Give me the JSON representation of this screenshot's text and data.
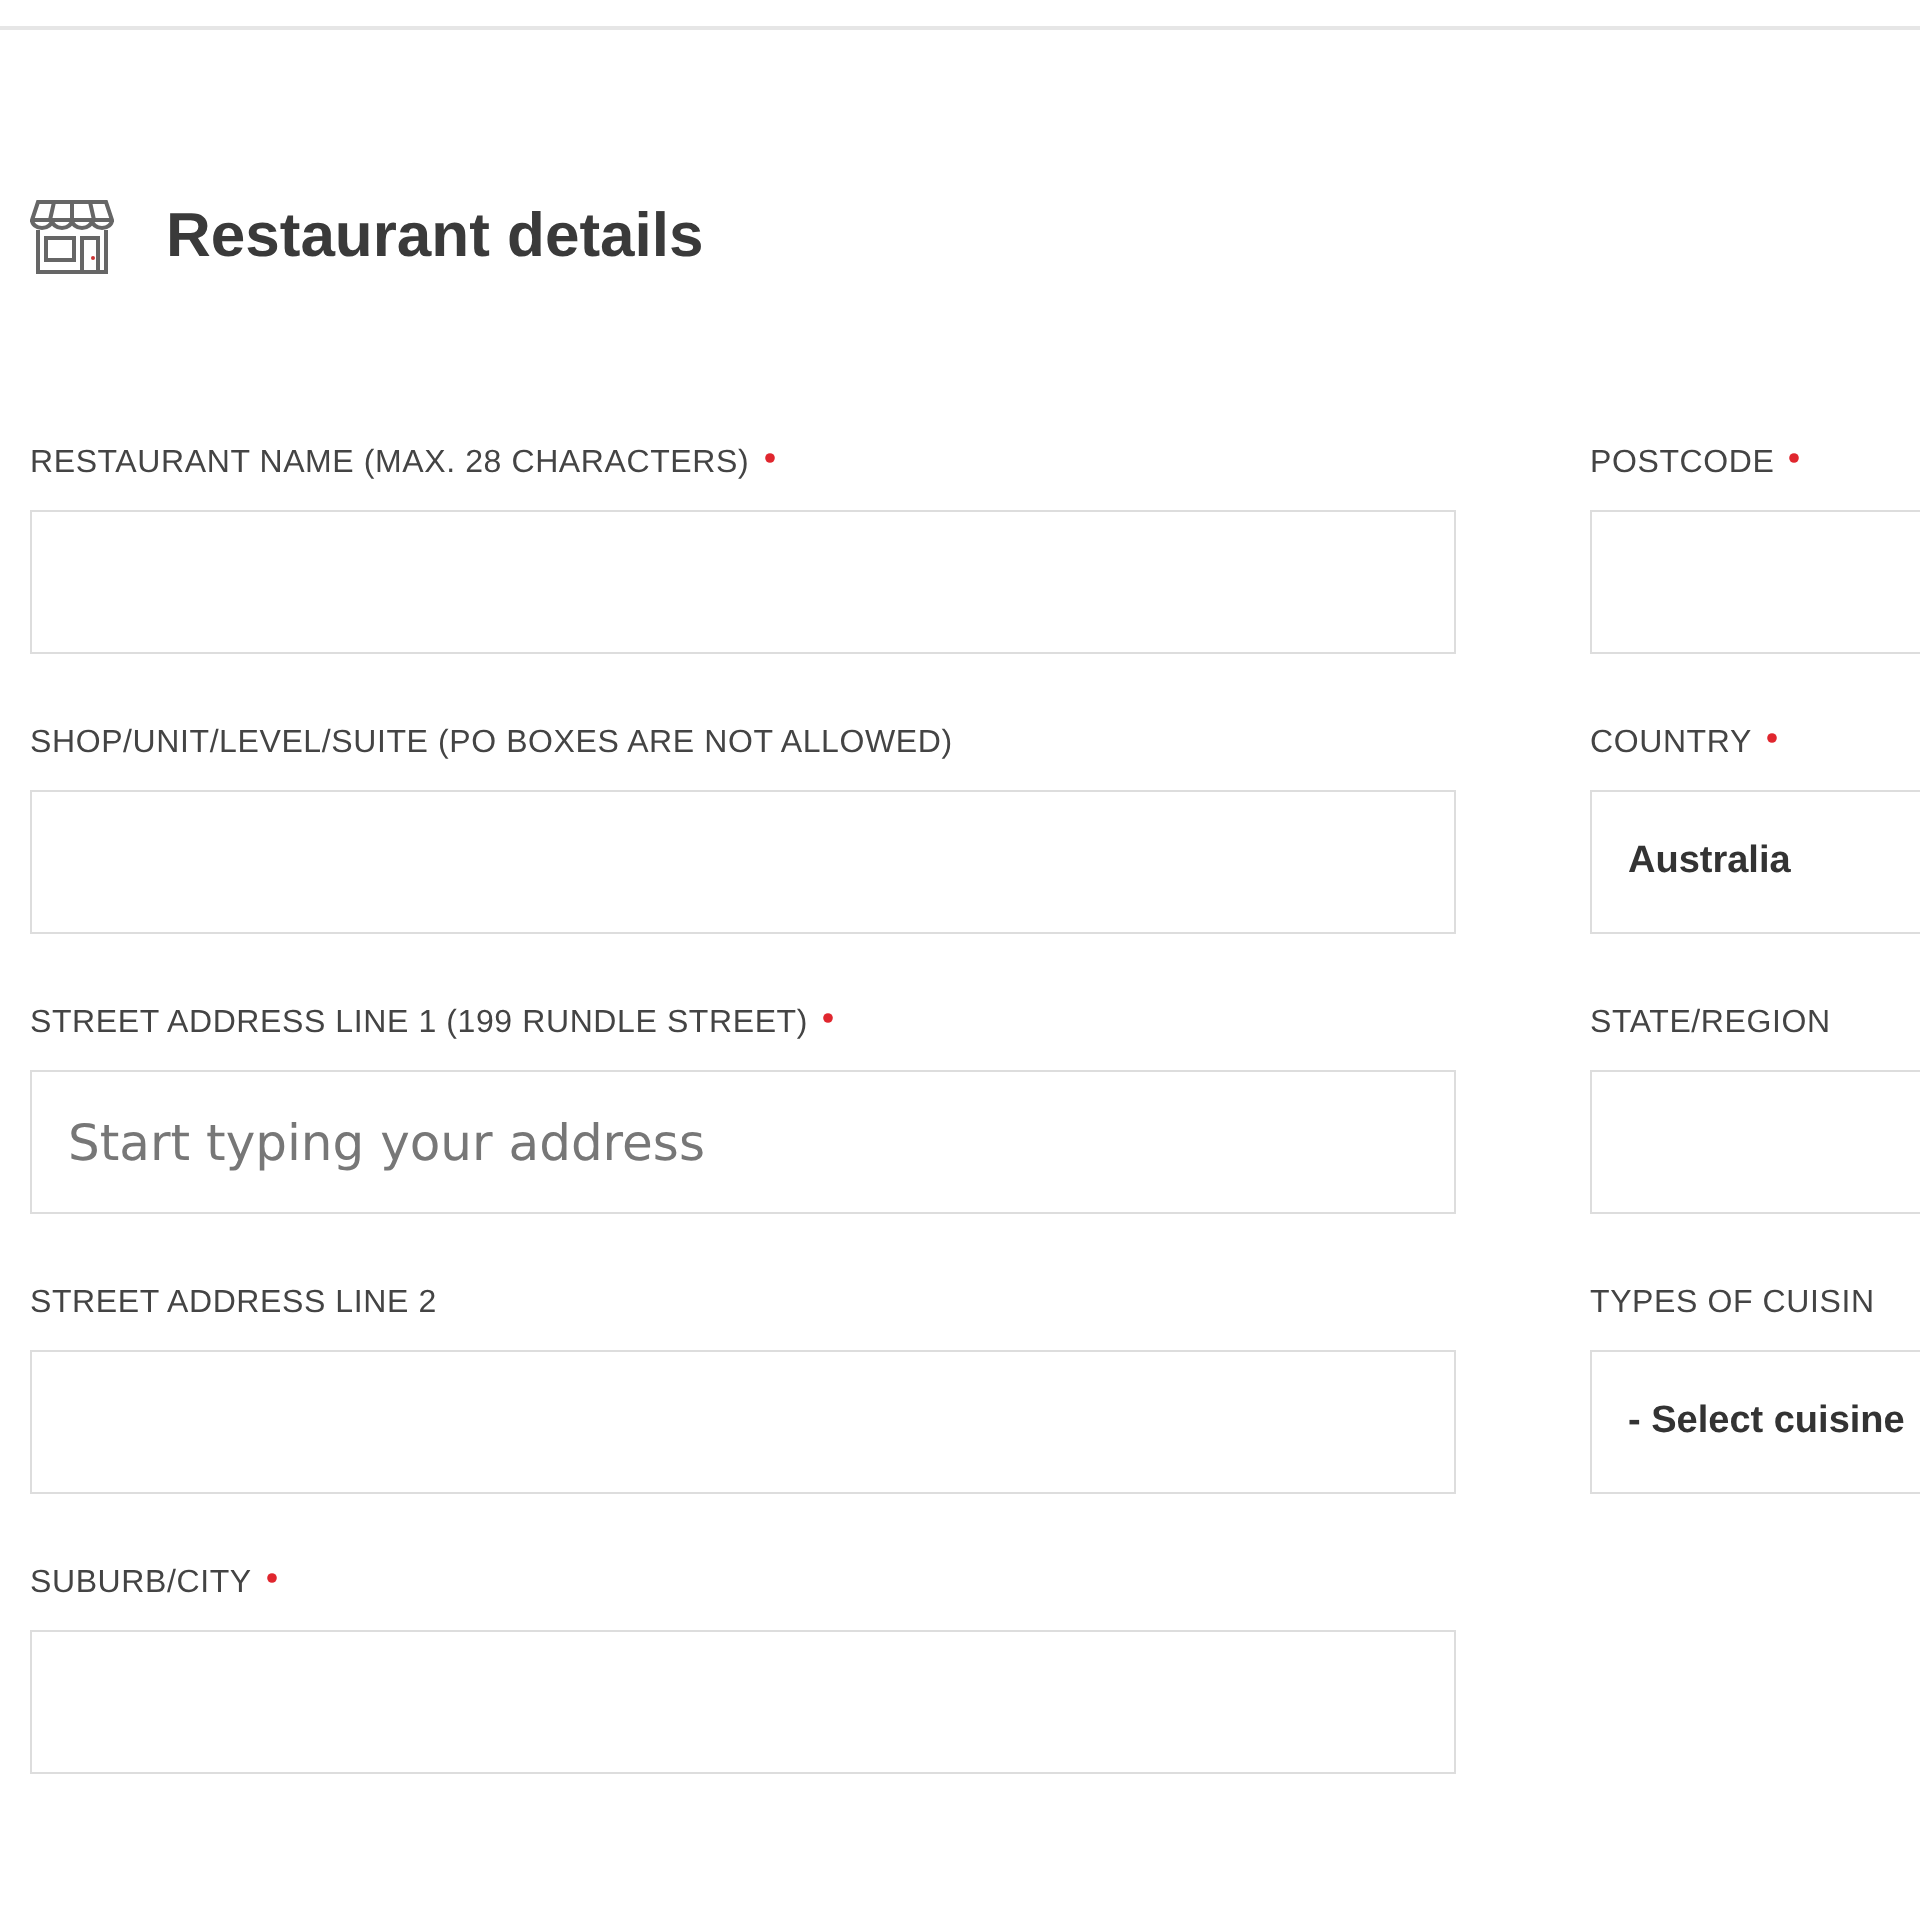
{
  "section": {
    "title": "Restaurant details"
  },
  "left_fields": [
    {
      "label": "RESTAURANT NAME (MAX. 28 CHARACTERS)",
      "required": true,
      "kind": "input"
    },
    {
      "label": "SHOP/UNIT/LEVEL/SUITE (PO BOXES ARE NOT ALLOWED)",
      "required": false,
      "kind": "input"
    },
    {
      "label": "STREET ADDRESS LINE 1 (199 RUNDLE STREET)",
      "required": true,
      "kind": "input",
      "placeholder": "Start typing your address"
    },
    {
      "label": "STREET ADDRESS LINE 2",
      "required": false,
      "kind": "input"
    },
    {
      "label": "SUBURB/CITY",
      "required": true,
      "kind": "input"
    }
  ],
  "right_fields": [
    {
      "label": "POSTCODE",
      "required": true,
      "kind": "input"
    },
    {
      "label": "COUNTRY",
      "required": true,
      "kind": "select",
      "value": "Australia"
    },
    {
      "label": "STATE/REGION",
      "required": false,
      "kind": "input"
    },
    {
      "label": "TYPES OF CUISIN",
      "required": false,
      "kind": "select",
      "value": "- Select cuisine"
    }
  ]
}
